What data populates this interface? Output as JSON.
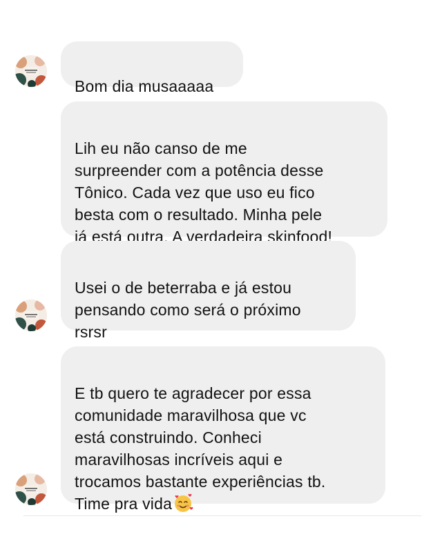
{
  "conversation": {
    "avatar_icon": "profile-avatar-icon",
    "messages": [
      {
        "text": "Bom dia musaaaaa"
      },
      {
        "text": "Lih eu não canso de me\nsurpreender com a potência desse\nTônico. Cada vez que uso eu fico\nbesta com o resultado.  Minha pele\njá está outra. A verdadeira skinfood!"
      },
      {
        "text": "Usei o de beterraba e já estou\npensando como será o próximo\nrsrsr"
      },
      {
        "text": "E tb quero te agradecer por essa\ncomunidade maravilhosa que vc\nestá construindo.  Conheci\nmaravilhosas incríveis aqui e\ntrocamos bastante experiências tb.\nTime pra vida",
        "trailing_emoji": "smiling-face-with-hearts-icon"
      }
    ]
  },
  "colors": {
    "bubble_background": "#efefef",
    "page_background": "#ffffff",
    "text": "#111111"
  }
}
